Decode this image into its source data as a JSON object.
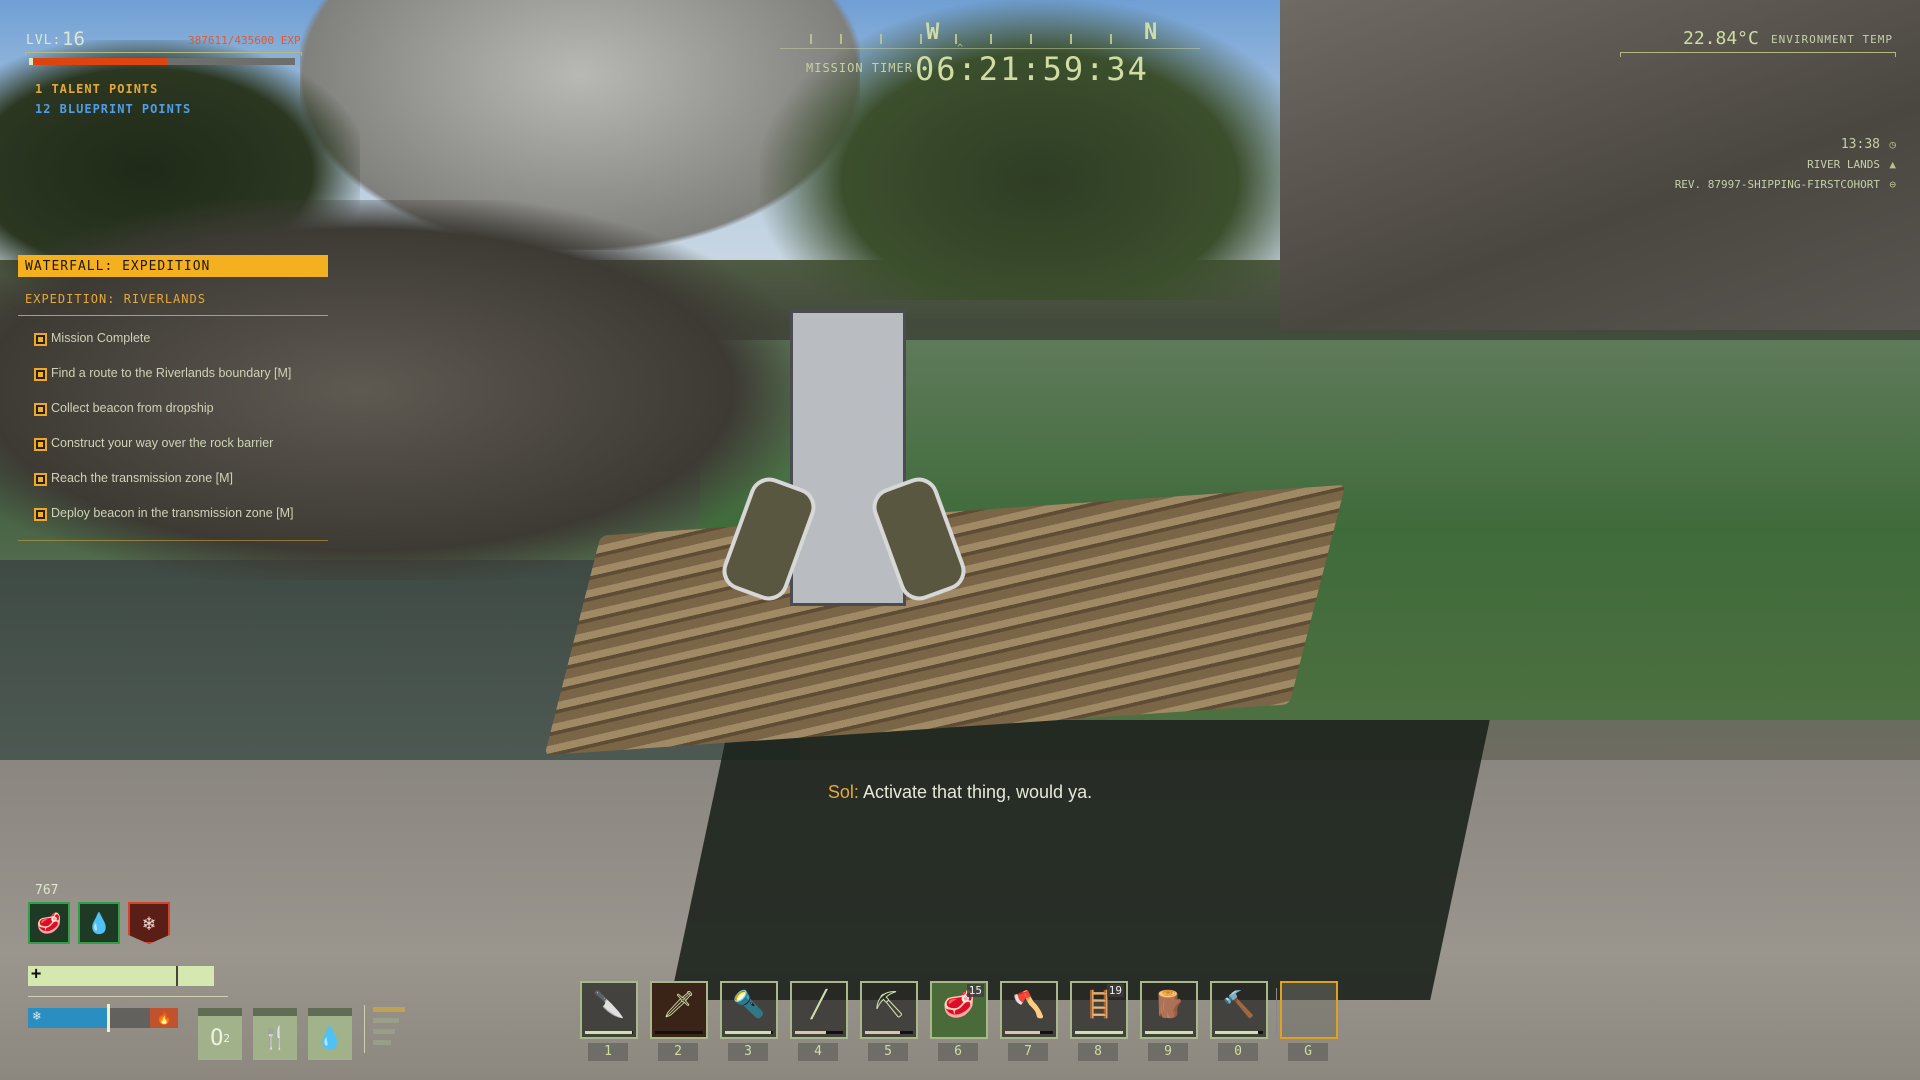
{
  "player": {
    "level_label": "LVL:",
    "level": "16",
    "exp_text": "387611/435600 EXP",
    "exp_progress": 0.52,
    "talent_points": "1 TALENT POINTS",
    "blueprint_points": "12 BLUEPRINT POINTS"
  },
  "compass": {
    "cardinals": [
      {
        "label": "W"
      },
      {
        "label": "N"
      }
    ],
    "timer_label": "MISSION TIMER",
    "timer_value": "06:21:59:34"
  },
  "environment": {
    "temperature": "22.84°C",
    "temperature_label": "ENVIRONMENT TEMP",
    "time": "13:38",
    "region": "RIVER LANDS",
    "build": "REV. 87997-SHIPPING-FIRSTCOHORT",
    "icons": {
      "time": "clock-icon",
      "region": "mountain-icon",
      "build": "arrow-circle-icon"
    }
  },
  "quest": {
    "title": "WATERFALL: EXPEDITION",
    "subtitle": "EXPEDITION: RIVERLANDS",
    "objectives": [
      {
        "text": "Mission Complete"
      },
      {
        "text": "Find a route to the Riverlands boundary [M]"
      },
      {
        "text": "Collect beacon from dropship"
      },
      {
        "text": "Construct your way over the rock barrier"
      },
      {
        "text": "Reach the transmission zone [M]"
      },
      {
        "text": "Deploy beacon in the transmission zone [M]"
      }
    ]
  },
  "dialogue": {
    "speaker": "Sol:",
    "line": "Activate that thing, would ya."
  },
  "status": {
    "count": "767",
    "effects": [
      {
        "name": "food-icon",
        "glyph": "🥩"
      },
      {
        "name": "water-drops-icon",
        "glyph": "💧"
      },
      {
        "name": "snowflake-icon",
        "glyph": "❄"
      }
    ],
    "health_plus": "+",
    "health_progress": 1.0,
    "body_temp_progress": 0.54,
    "cold_glyph": "❄",
    "hot_glyph": "🔥",
    "vitals": [
      {
        "name": "oxygen",
        "label": "O",
        "sub": "2"
      },
      {
        "name": "food",
        "glyph": "🍴"
      },
      {
        "name": "water",
        "glyph": "💧"
      }
    ]
  },
  "hotbar": {
    "slots": [
      {
        "key": "1",
        "item": "knife",
        "glyph": "🔪",
        "durability": 0.98,
        "dur_color": "#cfe3a8"
      },
      {
        "key": "2",
        "item": "broken-knife",
        "glyph": "🗡",
        "durability": 0,
        "dur_color": "#cfe3a8",
        "selected": true
      },
      {
        "key": "3",
        "item": "torch",
        "glyph": "🔦",
        "durability": 0.96,
        "dur_color": "#cfe3a8"
      },
      {
        "key": "4",
        "item": "spear",
        "glyph": "╱",
        "durability": 0.65,
        "dur_color": "#d9c9a0"
      },
      {
        "key": "5",
        "item": "pickaxe",
        "glyph": "⛏",
        "durability": 0.72,
        "dur_color": "#d9c9a0"
      },
      {
        "key": "6",
        "item": "cooked-meat",
        "glyph": "🥩",
        "count": "15",
        "food": true
      },
      {
        "key": "7",
        "item": "axe",
        "glyph": "🪓",
        "durability": 0.72,
        "dur_color": "#d9c9a0"
      },
      {
        "key": "8",
        "item": "ladder",
        "glyph": "🪜",
        "count": "19",
        "durability": 1.0,
        "dur_color": "#cfe3a8"
      },
      {
        "key": "9",
        "item": "wood-planks",
        "glyph": "🪵",
        "durability": 1.0,
        "dur_color": "#cfe3a8"
      },
      {
        "key": "0",
        "item": "hammer",
        "glyph": "🔨",
        "durability": 0.9,
        "dur_color": "#cfe3a8"
      },
      {
        "key": "G",
        "item": "empty",
        "glyph": "",
        "empty": true
      }
    ]
  }
}
